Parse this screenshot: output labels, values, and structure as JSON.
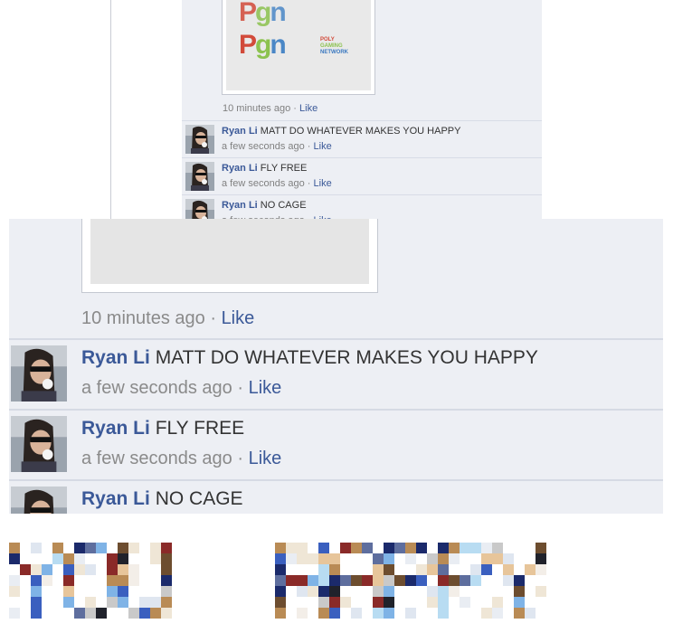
{
  "feed": {
    "image_meta": {
      "time": "10 minutes ago",
      "separator": "·",
      "like": "Like"
    },
    "logo": {
      "mark": "pgn",
      "tagline": [
        "POLY",
        "GAMING",
        "NETWORK"
      ]
    },
    "comments": [
      {
        "author": "Ryan Li",
        "text": "MATT DO WHATEVER MAKES YOU HAPPY",
        "time": "a few seconds ago",
        "like": "Like"
      },
      {
        "author": "Ryan Li",
        "text": "FLY FREE",
        "time": "a few seconds ago",
        "like": "Like"
      },
      {
        "author": "Ryan Li",
        "text": "NO CAGE",
        "time": "a few seconds ago",
        "like": "Like"
      }
    ]
  },
  "pixel_caption": "YOU HAPPY",
  "colors": {
    "link": "#3b5998",
    "panel_bg": "#edeff4",
    "meta_gray": "#8a8a8a",
    "logo_red": "#d24a3a",
    "logo_green": "#8cc24f",
    "logo_blue": "#4a87c6"
  }
}
